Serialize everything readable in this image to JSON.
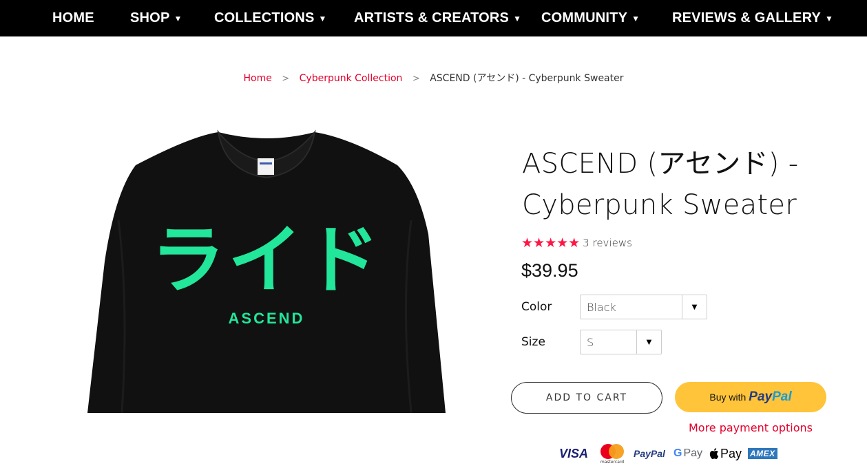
{
  "nav": {
    "items": [
      {
        "label": "HOME",
        "caret": ""
      },
      {
        "label": "SHOP",
        "caret": "▼"
      },
      {
        "label": "COLLECTIONS",
        "caret": "▼"
      },
      {
        "label": "ARTISTS & CREATORS",
        "caret": "▼"
      },
      {
        "label": "COMMUNITY",
        "caret": "▼"
      },
      {
        "label": "REVIEWS & GALLERY",
        "caret": "▼"
      }
    ]
  },
  "breadcrumb": {
    "home": "Home",
    "collection": "Cyberpunk Collection",
    "current": "ASCEND (アセンド) - Cyberpunk Sweater",
    "separator": ">"
  },
  "product": {
    "title_line1": "ASCEND (アセンド) -",
    "title_line2": "Cyberpunk Sweater",
    "stars": "★★★★★",
    "review_count": "3 reviews",
    "price": "$39.95",
    "image": {
      "print_jp": "ライド",
      "print_en": "ASCEND",
      "garment_color": "#111111",
      "print_color": "#22e69a"
    }
  },
  "options": {
    "color_label": "Color",
    "color_value": "Black",
    "size_label": "Size",
    "size_value": "S"
  },
  "actions": {
    "add_to_cart": "ADD TO CART",
    "paypal_buy": "Buy with",
    "paypal_pay": "Pay",
    "paypal_pal": "Pal",
    "more_payment": "More payment options"
  },
  "payment_methods": {
    "visa": "VISA",
    "mastercard": "mastercard",
    "paypal": "PayPal",
    "gpay_g": "G",
    "gpay": "Pay",
    "applepay": "Pay",
    "amex": "AMEX"
  },
  "colors": {
    "accent": "#e4002b",
    "star": "#ff1744",
    "paypal_yellow": "#ffc439"
  }
}
